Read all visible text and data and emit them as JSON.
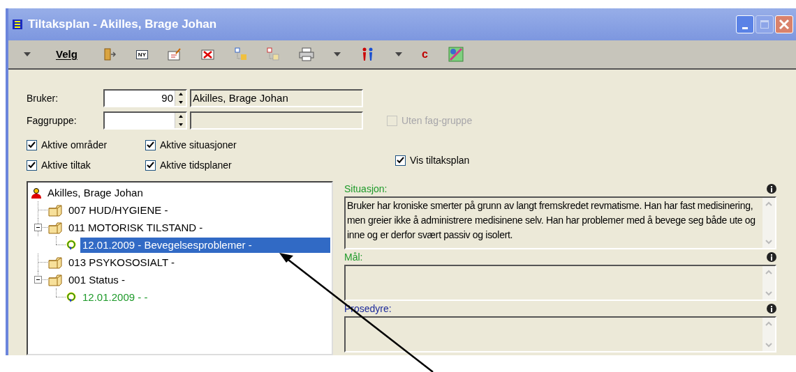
{
  "window": {
    "title": "Tiltaksplan - Akilles, Brage Johan"
  },
  "toolbar": [
    {
      "kind": "dropdown"
    },
    {
      "kind": "text",
      "label": "Velg"
    },
    {
      "kind": "exit"
    },
    {
      "kind": "new",
      "label": "NY"
    },
    {
      "kind": "edit"
    },
    {
      "kind": "delete"
    },
    {
      "kind": "tree-add"
    },
    {
      "kind": "tree-remove"
    },
    {
      "kind": "print"
    },
    {
      "kind": "dropdown"
    },
    {
      "kind": "people"
    },
    {
      "kind": "dropdown"
    },
    {
      "kind": "letter",
      "label": "c"
    },
    {
      "kind": "tools"
    }
  ],
  "form": {
    "bruker": {
      "label": "Bruker:",
      "value": "90",
      "name": "Akilles, Brage Johan"
    },
    "faggruppe": {
      "label": "Faggruppe:"
    },
    "uten_fag_gruppe": {
      "label": "Uten fag-gruppe",
      "checked": false,
      "disabled": true
    },
    "checkboxes": [
      {
        "label": "Aktive områder",
        "checked": true
      },
      {
        "label": "Aktive situasjoner",
        "checked": true
      },
      {
        "label": "Aktive tiltak",
        "checked": true
      },
      {
        "label": "Aktive tidsplaner",
        "checked": true
      }
    ],
    "vis_tiltaksplan": {
      "label": "Vis tiltaksplan",
      "checked": true
    }
  },
  "tree": [
    {
      "kind": "person",
      "label": "Akilles, Brage Johan",
      "selected": false,
      "children": [
        {
          "kind": "folder",
          "label": "007  HUD/HYGIENE -",
          "selected": false
        },
        {
          "kind": "folder",
          "label": "011  MOTORISK TILSTAND -",
          "selected": false,
          "expanded": true,
          "children": [
            {
              "kind": "plan",
              "label": "12.01.2009 - Bevegelsesproblemer -",
              "selected": true
            }
          ]
        },
        {
          "kind": "folder",
          "label": "013  PSYKOSOSIALT -",
          "selected": false
        },
        {
          "kind": "folder",
          "label": "001  Status -",
          "selected": false,
          "expanded": true,
          "children": [
            {
              "kind": "plan",
              "label": "12.01.2009 -  -",
              "selected": false,
              "color": "#1e9a2a"
            }
          ]
        }
      ]
    }
  ],
  "sections": [
    {
      "label": "Situasjon:",
      "color": "#1e9a2a",
      "text": "Bruker har kroniske smerter på grunn av langt fremskredet revmatisme. Han har fast medisinering, men greier ikke å administrere medisinene selv. Han har problemer med å bevege seg både ute og inne og er derfor svært passiv og isolert."
    },
    {
      "label": "Mål:",
      "color": "#1e9a2a"
    },
    {
      "label": "Prosedyre:",
      "color": "#1c2a9a"
    }
  ]
}
